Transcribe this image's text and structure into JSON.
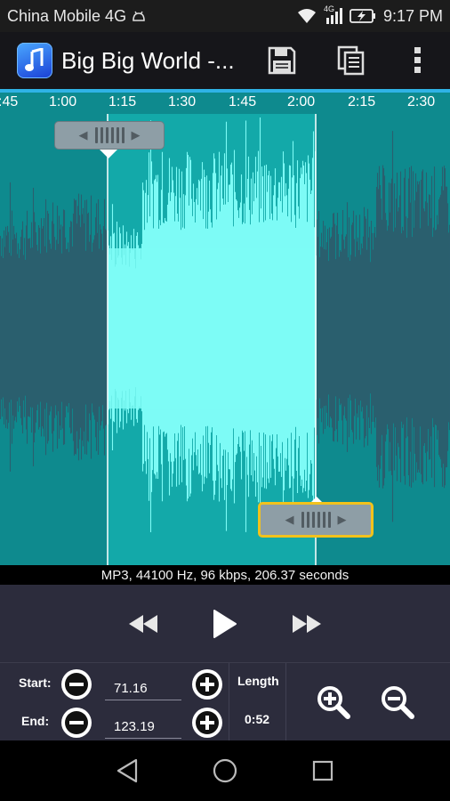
{
  "status_bar": {
    "carrier": "China Mobile 4G",
    "time": "9:17 PM",
    "network_label": "4G"
  },
  "action_bar": {
    "title": "Big Big World -...",
    "app_icon": "music-note-icon",
    "actions": [
      "save-icon",
      "copy-icon",
      "overflow-menu-icon"
    ]
  },
  "timeline": {
    "labels": [
      {
        "text": ":45"
      },
      {
        "text": "1:00"
      },
      {
        "text": "1:15"
      },
      {
        "text": "1:30"
      },
      {
        "text": "1:45"
      },
      {
        "text": "2:00"
      },
      {
        "text": "2:15"
      },
      {
        "text": "2:30"
      }
    ]
  },
  "waveform": {
    "selection_start_seconds": 71.16,
    "selection_end_seconds": 123.19,
    "background_color": "#0e8a8e",
    "selection_color": "#7dfbf6",
    "wave_color": "#2a5f6f"
  },
  "info": {
    "text": "MP3, 44100 Hz, 96 kbps, 206.37 seconds"
  },
  "controls": {
    "start_label": "Start:",
    "end_label": "End:",
    "start_value": "71.16",
    "end_value": "123.19",
    "length_label": "Length",
    "length_value": "0:52"
  },
  "colors": {
    "accent_blue": "#2fb3e6",
    "handle_active_border": "#f2c21c",
    "panel": "#2c2c3c"
  }
}
